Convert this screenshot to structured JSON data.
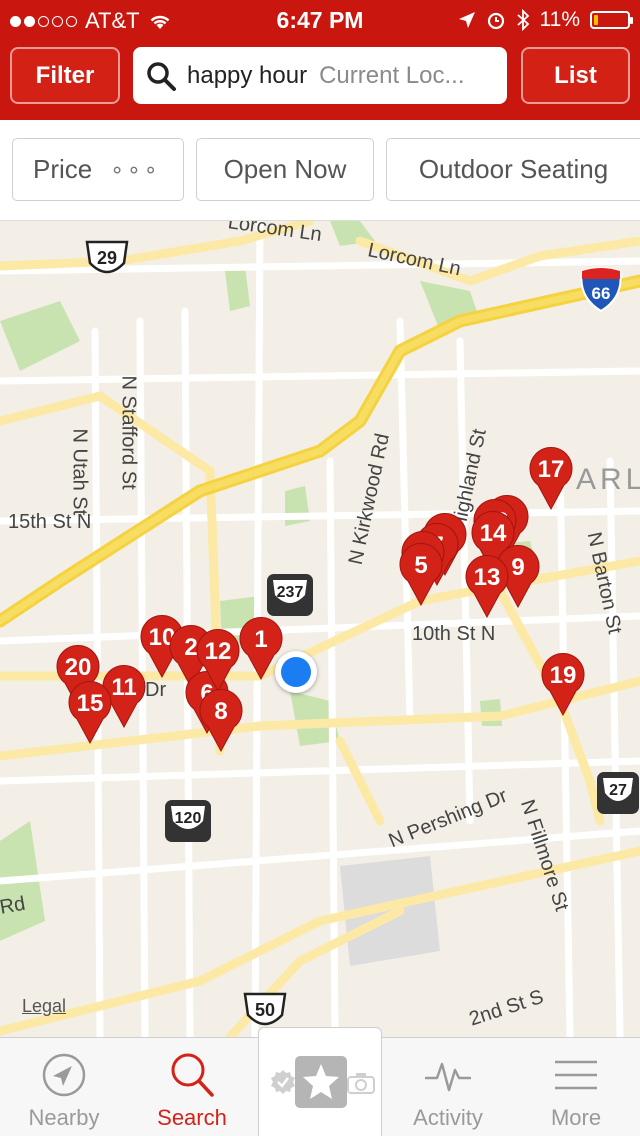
{
  "status_bar": {
    "carrier": "AT&T",
    "time": "6:47 PM",
    "battery": "11%",
    "battery_level": 0.11
  },
  "header": {
    "filter_label": "Filter",
    "search_term": "happy hour",
    "location_placeholder": "Current Loc...",
    "list_label": "List"
  },
  "filters": {
    "price": "Price",
    "price_more": "∘∘∘",
    "open_now": "Open Now",
    "outdoor": "Outdoor Seating"
  },
  "map": {
    "streets": {
      "lorcom": "Lorcom Ln",
      "lorcom_top": "Lorcom Ln",
      "n_stafford": "N Stafford St",
      "n_utah": "N Utah St",
      "fifteenth": "15th St N",
      "n_kirkwood": "N Kirkwood Rd",
      "highland": "Highland St",
      "n_barton": "N Barton St",
      "tenth": "10th St N",
      "n_pershing": "N Pershing Dr",
      "n_fillmore": "N Fillmore St",
      "second": "2nd St S",
      "dr": "Dr",
      "rd": "Rd",
      "arl": "ARL"
    },
    "shields": {
      "us29": "29",
      "i66": "66",
      "va237": "237",
      "va120": "120",
      "us50": "50",
      "va27": "27"
    },
    "legal": "Legal",
    "pins": [
      "17",
      "14",
      "9",
      "13",
      "5",
      "1",
      "12",
      "10",
      "2",
      "20",
      "11",
      "15",
      "8",
      "19",
      "6",
      "3",
      "7",
      "4",
      "16"
    ]
  },
  "tabs": {
    "nearby": "Nearby",
    "search": "Search",
    "activity": "Activity",
    "more": "More"
  },
  "colors": {
    "brand_red": "#c9170f",
    "pin_red": "#d32319",
    "user_blue": "#1a7df2"
  }
}
